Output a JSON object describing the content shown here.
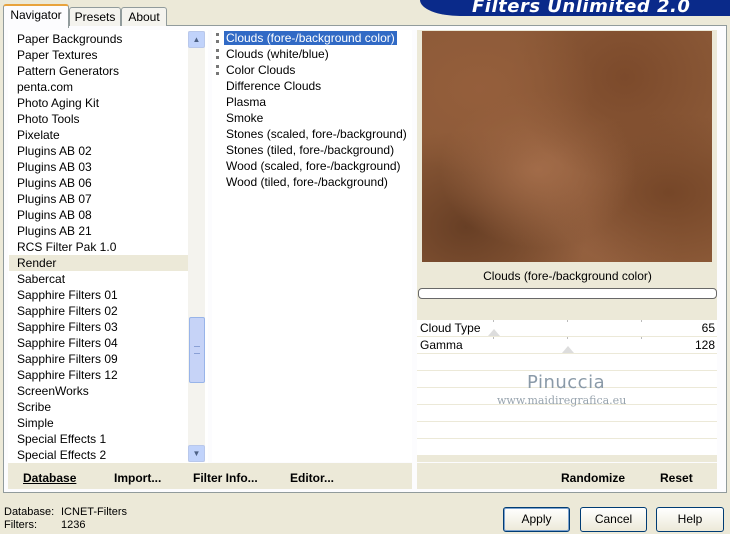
{
  "header": {
    "title": "Filters Unlimited 2.0"
  },
  "tabs": [
    {
      "label": "Navigator"
    },
    {
      "label": "Presets"
    },
    {
      "label": "About"
    }
  ],
  "categories": [
    "Paper Backgrounds",
    "Paper Textures",
    "Pattern Generators",
    "penta.com",
    "Photo Aging Kit",
    "Photo Tools",
    "Pixelate",
    "Plugins AB 02",
    "Plugins AB 03",
    "Plugins AB 06",
    "Plugins AB 07",
    "Plugins AB 08",
    "Plugins AB 21",
    "RCS Filter Pak 1.0",
    "Render",
    "Sabercat",
    "Sapphire Filters 01",
    "Sapphire Filters 02",
    "Sapphire Filters 03",
    "Sapphire Filters 04",
    "Sapphire Filters 09",
    "Sapphire Filters 12",
    "ScreenWorks",
    "Scribe",
    "Simple",
    "Special Effects 1",
    "Special Effects 2"
  ],
  "selected_category": "Render",
  "filters": [
    "Clouds (fore-/background color)",
    "Clouds (white/blue)",
    "Color Clouds",
    "Difference Clouds",
    "Plasma",
    "Smoke",
    "Stones (scaled, fore-/background)",
    "Stones (tiled, fore-/background)",
    "Wood (scaled, fore-/background)",
    "Wood (tiled, fore-/background)"
  ],
  "selected_filter": "Clouds (fore-/background color)",
  "preview": {
    "label": "Clouds (fore-/background color)",
    "progress": 0
  },
  "sliders": [
    {
      "label": "Cloud Type",
      "value": "65"
    },
    {
      "label": "Gamma",
      "value": "128"
    }
  ],
  "watermark": {
    "title": "Pinuccia",
    "site": "www.maidiregrafica.eu"
  },
  "left_buttons": {
    "database": "Database",
    "import": "Import...",
    "filter_info": "Filter Info...",
    "editor": "Editor..."
  },
  "right_buttons": {
    "randomize": "Randomize",
    "reset": "Reset"
  },
  "status": {
    "database_label": "Database:",
    "database_value": "ICNET-Filters",
    "filters_label": "Filters:",
    "filters_value": "1236"
  },
  "dialog_buttons": {
    "apply": "Apply",
    "cancel": "Cancel",
    "help": "Help"
  },
  "colors": {
    "selection": "#316ac5",
    "banner": "#0a2a8a",
    "preview_base": "#8c5a38"
  }
}
